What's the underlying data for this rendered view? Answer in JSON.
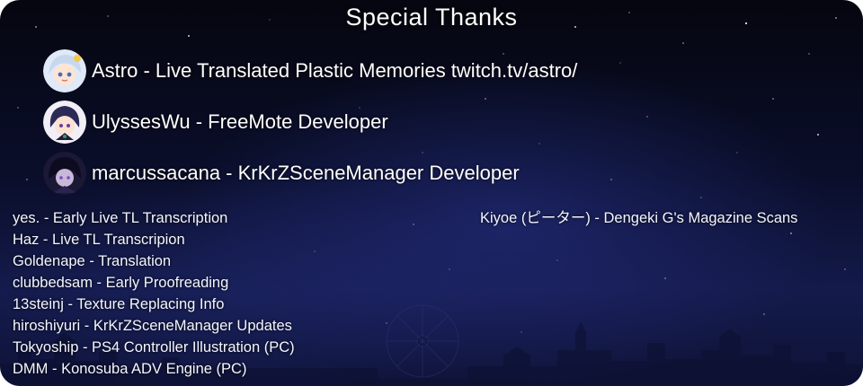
{
  "title": "Special Thanks",
  "featured_credits": [
    {
      "avatar_icon": "avatar-astro-icon",
      "text": "Astro - Live Translated Plastic Memories twitch.tv/astro/"
    },
    {
      "avatar_icon": "avatar-ulysseswu-icon",
      "text": "UlyssesWu - FreeMote Developer"
    },
    {
      "avatar_icon": "avatar-marcussacana-icon",
      "text": "marcussacana - KrKrZSceneManager Developer"
    }
  ],
  "contributors": [
    "yes. - Early Live TL Transcription",
    "Haz - Live TL Transcripion",
    "Goldenape - Translation",
    "clubbedsam - Early Proofreading",
    "13steinj - Texture Replacing Info",
    "hiroshiyuri - KrKrZSceneManager Updates",
    "Tokyoship - PS4 Controller Illustration (PC)",
    "DMM - Konosuba ADV Engine (PC)"
  ],
  "side_credit": "Kiyoe (ピーター) - Dengeki G's Magazine Scans",
  "colors": {
    "background_top": "#05060f",
    "background_bottom": "#141a4a",
    "text": "#ffffff"
  }
}
